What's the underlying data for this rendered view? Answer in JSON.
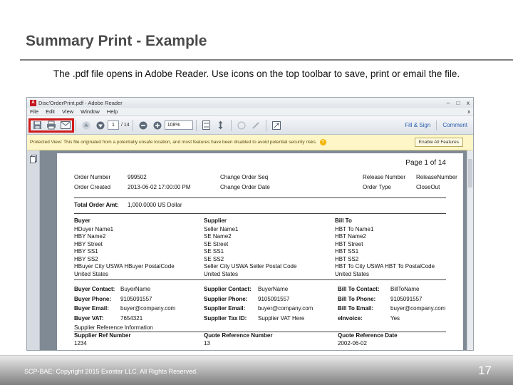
{
  "slide": {
    "title": "Summary Print - Example",
    "subtitle": "The .pdf file opens in Adobe Reader.  Use icons on the top toolbar to save, print or email the file."
  },
  "window": {
    "title": "Disc'OrderPrint.pdf - Adobe Reader",
    "controls": [
      "–",
      "□",
      "x"
    ]
  },
  "menu": {
    "items": [
      "File",
      "Edit",
      "View",
      "Window",
      "Help"
    ],
    "close": "x"
  },
  "toolbar": {
    "icons": [
      "save-icon",
      "print-icon",
      "email-icon"
    ],
    "page_input": "1",
    "page_total": "/ 14",
    "zoom": "108%",
    "fill_sign": "Fill & Sign",
    "comment": "Comment"
  },
  "protected_bar": {
    "message": "Protected View: This file originated from a potentially unsafe location, and most features have been disabled to avoid potential security risks.",
    "help": "?",
    "enable_button": "Enable All Features"
  },
  "document": {
    "page_label": "Page 1 of 14",
    "header": [
      {
        "k1": "Order Number",
        "v1": "999502",
        "k2": "Change Order Seq",
        "v2": "",
        "k3": "Release Number",
        "v3": "ReleaseNumber"
      },
      {
        "k1": "Order Created",
        "v1": "2013-06-02 17:00:00 PM",
        "k2": "Change Order Date",
        "v2": "",
        "k3": "Order Type",
        "v3": "CloseOut"
      }
    ],
    "total_label": "Total Order Amt:",
    "total_value": "1,000.0000 US Dollar",
    "buyer": {
      "heading": "Buyer",
      "lines": [
        "HDuyer Name1",
        "HBY Name2",
        "HBY Street",
        "HBY SS1",
        "HBY SS2",
        "HBuyer City USWA HBuyer PostalCode",
        "United States"
      ]
    },
    "supplier": {
      "heading": "Supplier",
      "lines": [
        "Seller Name1",
        "SE Name2",
        "SE Street",
        "SE SS1",
        "SE SS2",
        "Seller City USWA Seller Postal Code",
        "United States"
      ]
    },
    "billto": {
      "heading": "Bill To",
      "lines": [
        "HBT To Name1",
        "HBT Name2",
        "HBT Street",
        "HBT SS1",
        "HBT SS2",
        "HBT To City USWA HBT To PostalCode",
        "United States"
      ]
    },
    "buyer_contacts": [
      {
        "k": "Buyer Contact:",
        "v": "BuyerName"
      },
      {
        "k": "Buyer Phone:",
        "v": "9105091557"
      },
      {
        "k": "Buyer Email:",
        "v": "buyer@company.com"
      },
      {
        "k": "Buyer VAT:",
        "v": "7654321"
      }
    ],
    "supplier_contacts": [
      {
        "k": "Supplier Contact:",
        "v": "BuyerName"
      },
      {
        "k": "Supplier Phone:",
        "v": "9105091557"
      },
      {
        "k": "Supplier Email:",
        "v": "buyer@company.com"
      },
      {
        "k": "Supplier Tax ID:",
        "v": "Supplier VAT Here"
      }
    ],
    "bill_contacts": [
      {
        "k": "Bill To Contact:",
        "v": "BillToName"
      },
      {
        "k": "Bill To Phone:",
        "v": "9105091557"
      },
      {
        "k": "Bill To Email:",
        "v": "buyer@company.com"
      },
      {
        "k": "eInvoice:",
        "v": "Yes"
      }
    ],
    "supplier_ref_info": "Supplier Reference Information",
    "supplier_ref": {
      "heading": "Supplier Ref Number",
      "value": "1234"
    },
    "quote_ref": {
      "heading": "Quote Reference Number",
      "value": "13"
    },
    "quote_date": {
      "heading": "Quote Reference Date",
      "value": "2002-06-02"
    }
  },
  "footer": {
    "copyright": "SCP-BAE:  Copyright 2015 Exostar LLC. All Rights Reserved.",
    "page_number": "17"
  }
}
